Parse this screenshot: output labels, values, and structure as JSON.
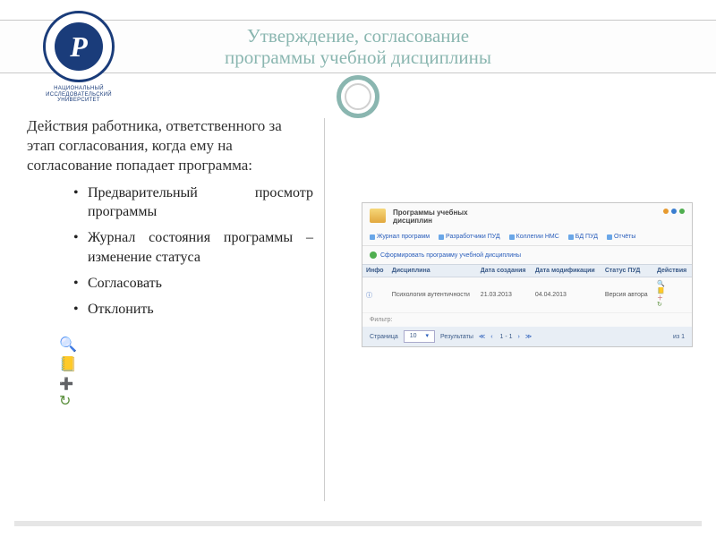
{
  "header": {
    "title_line1": "Утверждение, согласование",
    "title_line2": "программы учебной дисциплины"
  },
  "logo": {
    "letter": "Р",
    "caption_line": "НАЦИОНАЛЬНЫЙ ИССЛЕДОВАТЕЛЬСКИЙ",
    "caption_line2": "УНИВЕРСИТЕТ"
  },
  "left": {
    "intro": "Действия работника, ответственного за этап согласования, когда ему на согласование попадает программа:",
    "bullets": [
      "Предварительный просмотр программы",
      "Журнал состояния программы – изменение статуса",
      "Согласовать",
      "Отклонить"
    ],
    "icons": [
      "🔍",
      "📒",
      "➕",
      "↻"
    ]
  },
  "screenshot": {
    "heading_l1": "Программы учебных",
    "heading_l2": "дисциплин",
    "tabs": [
      "Журнал программ",
      "Разработчики ПУД",
      "Коллегии НМС",
      "БД ПУД",
      "Отчёты"
    ],
    "action": "Сформировать программу учебной дисциплины",
    "columns": [
      "Инфо",
      "Дисциплина",
      "Дата создания",
      "Дата модификации",
      "Статус ПУД",
      "Действия"
    ],
    "row": {
      "discipline": "Психология аутентичности",
      "created": "21.03.2013",
      "modified": "04.04.2013",
      "status": "Версия автора"
    },
    "filter_label": "Фильтр:",
    "pager": {
      "page_label": "Страница",
      "page_value": "10",
      "results_label": "Результаты",
      "range": "1 - 1",
      "total": "из 1"
    }
  }
}
